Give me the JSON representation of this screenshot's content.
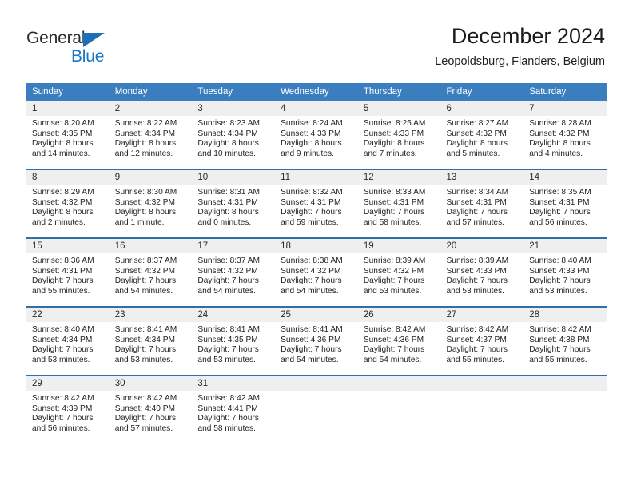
{
  "brand": {
    "logo_primary": "General",
    "logo_secondary": "Blue",
    "logo_icon": "triangle-flag-icon",
    "accent_color": "#1878c8",
    "header_bar_color": "#3a7ebf"
  },
  "header": {
    "title": "December 2024",
    "subtitle": "Leopoldsburg, Flanders, Belgium"
  },
  "calendar": {
    "weekday_headers": [
      "Sunday",
      "Monday",
      "Tuesday",
      "Wednesday",
      "Thursday",
      "Friday",
      "Saturday"
    ],
    "weeks": [
      [
        {
          "day": "1",
          "sunrise": "Sunrise: 8:20 AM",
          "sunset": "Sunset: 4:35 PM",
          "daylight_line1": "Daylight: 8 hours",
          "daylight_line2": "and 14 minutes."
        },
        {
          "day": "2",
          "sunrise": "Sunrise: 8:22 AM",
          "sunset": "Sunset: 4:34 PM",
          "daylight_line1": "Daylight: 8 hours",
          "daylight_line2": "and 12 minutes."
        },
        {
          "day": "3",
          "sunrise": "Sunrise: 8:23 AM",
          "sunset": "Sunset: 4:34 PM",
          "daylight_line1": "Daylight: 8 hours",
          "daylight_line2": "and 10 minutes."
        },
        {
          "day": "4",
          "sunrise": "Sunrise: 8:24 AM",
          "sunset": "Sunset: 4:33 PM",
          "daylight_line1": "Daylight: 8 hours",
          "daylight_line2": "and 9 minutes."
        },
        {
          "day": "5",
          "sunrise": "Sunrise: 8:25 AM",
          "sunset": "Sunset: 4:33 PM",
          "daylight_line1": "Daylight: 8 hours",
          "daylight_line2": "and 7 minutes."
        },
        {
          "day": "6",
          "sunrise": "Sunrise: 8:27 AM",
          "sunset": "Sunset: 4:32 PM",
          "daylight_line1": "Daylight: 8 hours",
          "daylight_line2": "and 5 minutes."
        },
        {
          "day": "7",
          "sunrise": "Sunrise: 8:28 AM",
          "sunset": "Sunset: 4:32 PM",
          "daylight_line1": "Daylight: 8 hours",
          "daylight_line2": "and 4 minutes."
        }
      ],
      [
        {
          "day": "8",
          "sunrise": "Sunrise: 8:29 AM",
          "sunset": "Sunset: 4:32 PM",
          "daylight_line1": "Daylight: 8 hours",
          "daylight_line2": "and 2 minutes."
        },
        {
          "day": "9",
          "sunrise": "Sunrise: 8:30 AM",
          "sunset": "Sunset: 4:32 PM",
          "daylight_line1": "Daylight: 8 hours",
          "daylight_line2": "and 1 minute."
        },
        {
          "day": "10",
          "sunrise": "Sunrise: 8:31 AM",
          "sunset": "Sunset: 4:31 PM",
          "daylight_line1": "Daylight: 8 hours",
          "daylight_line2": "and 0 minutes."
        },
        {
          "day": "11",
          "sunrise": "Sunrise: 8:32 AM",
          "sunset": "Sunset: 4:31 PM",
          "daylight_line1": "Daylight: 7 hours",
          "daylight_line2": "and 59 minutes."
        },
        {
          "day": "12",
          "sunrise": "Sunrise: 8:33 AM",
          "sunset": "Sunset: 4:31 PM",
          "daylight_line1": "Daylight: 7 hours",
          "daylight_line2": "and 58 minutes."
        },
        {
          "day": "13",
          "sunrise": "Sunrise: 8:34 AM",
          "sunset": "Sunset: 4:31 PM",
          "daylight_line1": "Daylight: 7 hours",
          "daylight_line2": "and 57 minutes."
        },
        {
          "day": "14",
          "sunrise": "Sunrise: 8:35 AM",
          "sunset": "Sunset: 4:31 PM",
          "daylight_line1": "Daylight: 7 hours",
          "daylight_line2": "and 56 minutes."
        }
      ],
      [
        {
          "day": "15",
          "sunrise": "Sunrise: 8:36 AM",
          "sunset": "Sunset: 4:31 PM",
          "daylight_line1": "Daylight: 7 hours",
          "daylight_line2": "and 55 minutes."
        },
        {
          "day": "16",
          "sunrise": "Sunrise: 8:37 AM",
          "sunset": "Sunset: 4:32 PM",
          "daylight_line1": "Daylight: 7 hours",
          "daylight_line2": "and 54 minutes."
        },
        {
          "day": "17",
          "sunrise": "Sunrise: 8:37 AM",
          "sunset": "Sunset: 4:32 PM",
          "daylight_line1": "Daylight: 7 hours",
          "daylight_line2": "and 54 minutes."
        },
        {
          "day": "18",
          "sunrise": "Sunrise: 8:38 AM",
          "sunset": "Sunset: 4:32 PM",
          "daylight_line1": "Daylight: 7 hours",
          "daylight_line2": "and 54 minutes."
        },
        {
          "day": "19",
          "sunrise": "Sunrise: 8:39 AM",
          "sunset": "Sunset: 4:32 PM",
          "daylight_line1": "Daylight: 7 hours",
          "daylight_line2": "and 53 minutes."
        },
        {
          "day": "20",
          "sunrise": "Sunrise: 8:39 AM",
          "sunset": "Sunset: 4:33 PM",
          "daylight_line1": "Daylight: 7 hours",
          "daylight_line2": "and 53 minutes."
        },
        {
          "day": "21",
          "sunrise": "Sunrise: 8:40 AM",
          "sunset": "Sunset: 4:33 PM",
          "daylight_line1": "Daylight: 7 hours",
          "daylight_line2": "and 53 minutes."
        }
      ],
      [
        {
          "day": "22",
          "sunrise": "Sunrise: 8:40 AM",
          "sunset": "Sunset: 4:34 PM",
          "daylight_line1": "Daylight: 7 hours",
          "daylight_line2": "and 53 minutes."
        },
        {
          "day": "23",
          "sunrise": "Sunrise: 8:41 AM",
          "sunset": "Sunset: 4:34 PM",
          "daylight_line1": "Daylight: 7 hours",
          "daylight_line2": "and 53 minutes."
        },
        {
          "day": "24",
          "sunrise": "Sunrise: 8:41 AM",
          "sunset": "Sunset: 4:35 PM",
          "daylight_line1": "Daylight: 7 hours",
          "daylight_line2": "and 53 minutes."
        },
        {
          "day": "25",
          "sunrise": "Sunrise: 8:41 AM",
          "sunset": "Sunset: 4:36 PM",
          "daylight_line1": "Daylight: 7 hours",
          "daylight_line2": "and 54 minutes."
        },
        {
          "day": "26",
          "sunrise": "Sunrise: 8:42 AM",
          "sunset": "Sunset: 4:36 PM",
          "daylight_line1": "Daylight: 7 hours",
          "daylight_line2": "and 54 minutes."
        },
        {
          "day": "27",
          "sunrise": "Sunrise: 8:42 AM",
          "sunset": "Sunset: 4:37 PM",
          "daylight_line1": "Daylight: 7 hours",
          "daylight_line2": "and 55 minutes."
        },
        {
          "day": "28",
          "sunrise": "Sunrise: 8:42 AM",
          "sunset": "Sunset: 4:38 PM",
          "daylight_line1": "Daylight: 7 hours",
          "daylight_line2": "and 55 minutes."
        }
      ],
      [
        {
          "day": "29",
          "sunrise": "Sunrise: 8:42 AM",
          "sunset": "Sunset: 4:39 PM",
          "daylight_line1": "Daylight: 7 hours",
          "daylight_line2": "and 56 minutes."
        },
        {
          "day": "30",
          "sunrise": "Sunrise: 8:42 AM",
          "sunset": "Sunset: 4:40 PM",
          "daylight_line1": "Daylight: 7 hours",
          "daylight_line2": "and 57 minutes."
        },
        {
          "day": "31",
          "sunrise": "Sunrise: 8:42 AM",
          "sunset": "Sunset: 4:41 PM",
          "daylight_line1": "Daylight: 7 hours",
          "daylight_line2": "and 58 minutes."
        },
        {
          "day": "",
          "sunrise": "",
          "sunset": "",
          "daylight_line1": "",
          "daylight_line2": ""
        },
        {
          "day": "",
          "sunrise": "",
          "sunset": "",
          "daylight_line1": "",
          "daylight_line2": ""
        },
        {
          "day": "",
          "sunrise": "",
          "sunset": "",
          "daylight_line1": "",
          "daylight_line2": ""
        },
        {
          "day": "",
          "sunrise": "",
          "sunset": "",
          "daylight_line1": "",
          "daylight_line2": ""
        }
      ]
    ]
  }
}
